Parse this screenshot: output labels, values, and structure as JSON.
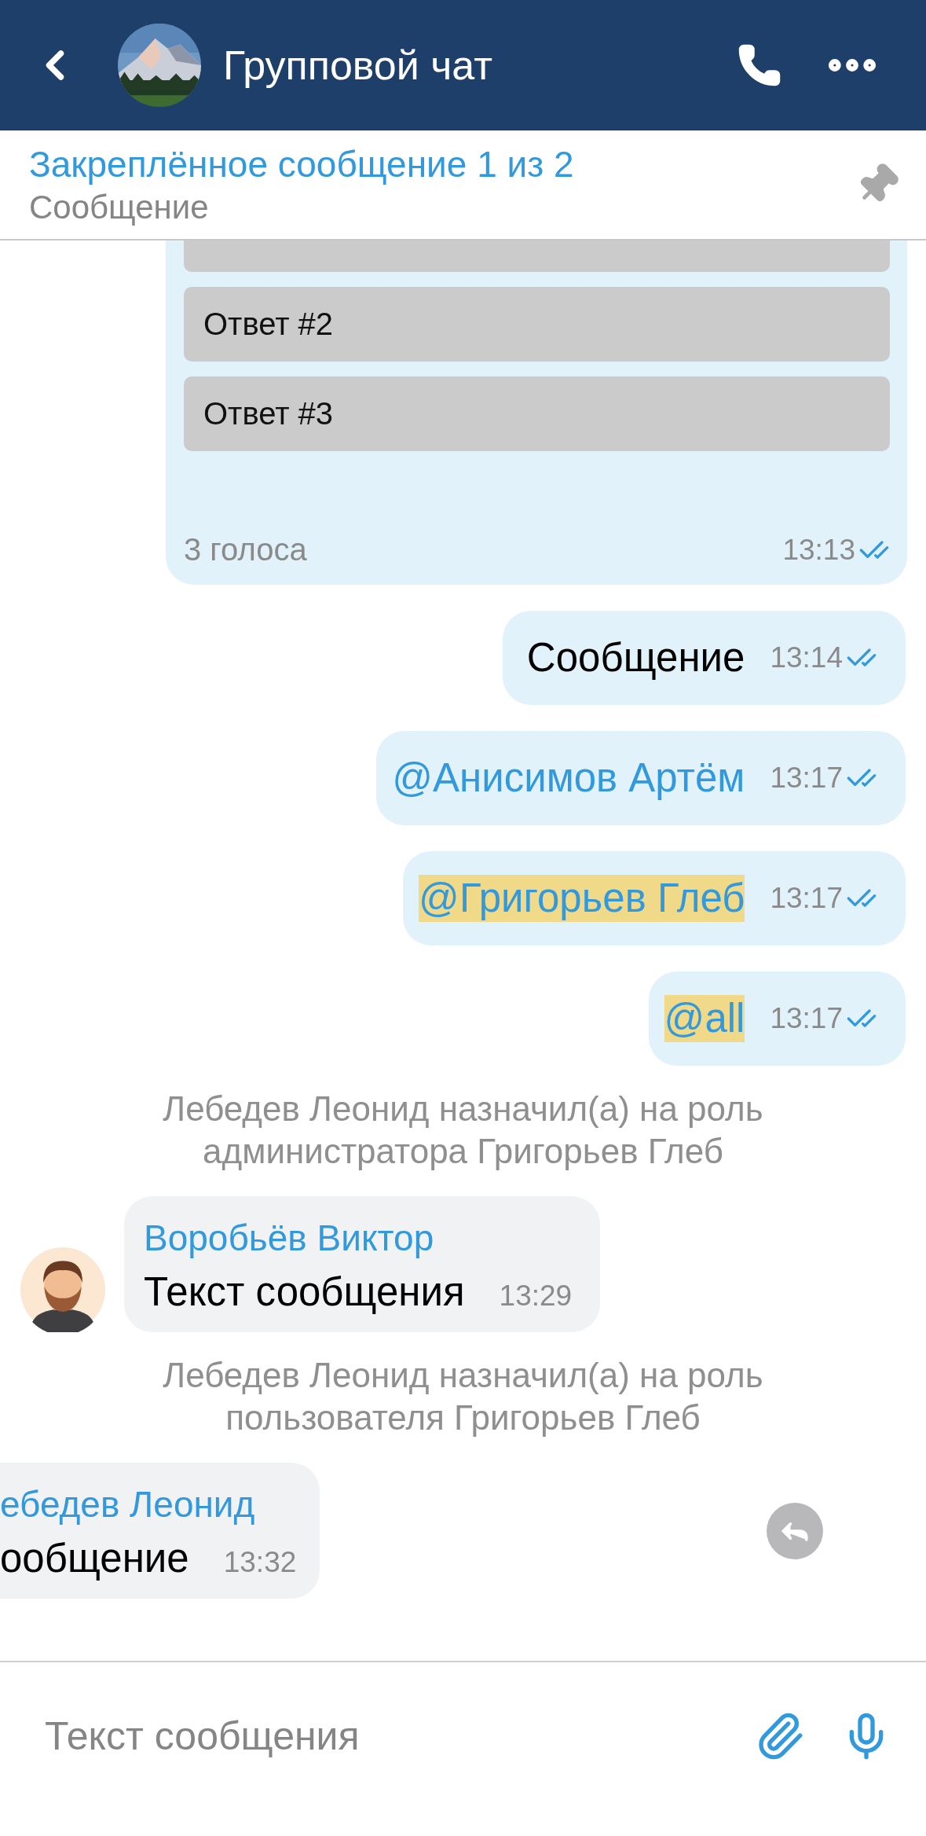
{
  "header": {
    "title": "Групповой чат"
  },
  "pinned": {
    "title": "Закреплённое сообщение 1 из 2",
    "preview": "Сообщение"
  },
  "messages": [
    {
      "kind": "poll",
      "options": [
        "Ответ #2",
        "Ответ #3"
      ],
      "votes": "3 голоса",
      "time": "13:13",
      "read": true
    },
    {
      "kind": "outgoing",
      "text": "Сообщение",
      "mention": false,
      "highlighted": false,
      "time": "13:14",
      "read": true
    },
    {
      "kind": "outgoing",
      "text": "@Анисимов Артём",
      "mention": true,
      "highlighted": false,
      "time": "13:17",
      "read": true
    },
    {
      "kind": "outgoing",
      "text": "@Григорьев Глеб",
      "mention": true,
      "highlighted": true,
      "time": "13:17",
      "read": true
    },
    {
      "kind": "outgoing",
      "text": "@all",
      "mention": true,
      "highlighted": true,
      "time": "13:17",
      "read": true
    },
    {
      "kind": "system",
      "text": "Лебедев Леонид назначил(а) на роль\nадминистратора Григорьев Глеб"
    },
    {
      "kind": "incoming",
      "author": "Воробьёв Виктор",
      "text": "Текст сообщения",
      "time": "13:29",
      "avatar": true,
      "reply_hint": false
    },
    {
      "kind": "system",
      "text": "Лебедев Леонид назначил(а) на роль\nпользователя Григорьев Глеб"
    },
    {
      "kind": "incoming",
      "author": "ебедев Леонид",
      "text": "ообщение",
      "time": "13:32",
      "avatar": false,
      "reply_hint": true
    }
  ],
  "composer": {
    "placeholder": "Текст сообщения"
  }
}
